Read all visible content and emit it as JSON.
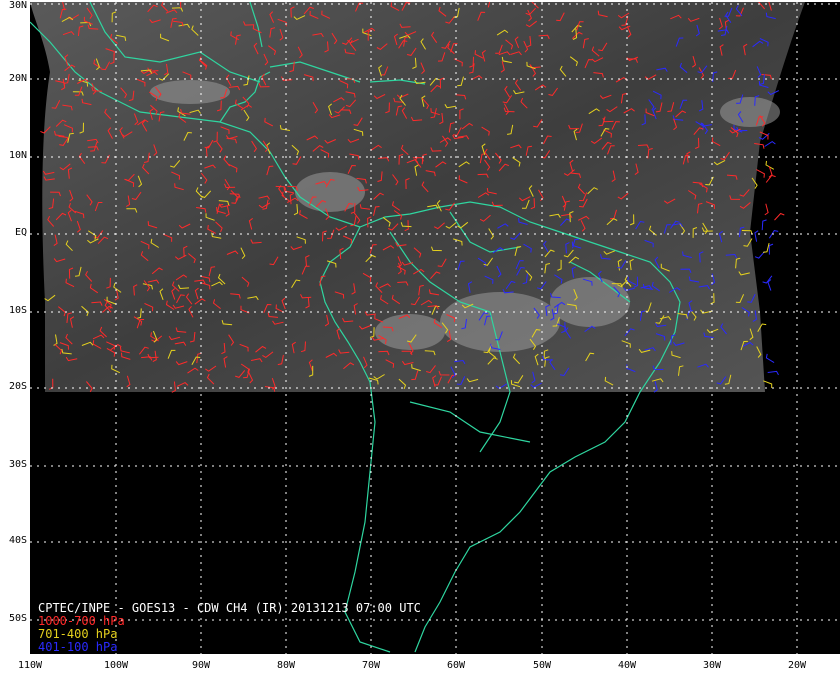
{
  "map": {
    "lat_labels": [
      "30N",
      "20N",
      "10N",
      "EQ",
      "10S",
      "20S",
      "30S",
      "40S",
      "50S"
    ],
    "lon_labels": [
      "110W",
      "100W",
      "90W",
      "80W",
      "70W",
      "60W",
      "50W",
      "40W",
      "30W",
      "20W"
    ],
    "extent": {
      "lon_min": -110,
      "lon_max": -15,
      "lat_min": -55,
      "lat_max": 30
    }
  },
  "caption": {
    "title": "CPTEC/INPE - GOES13 - CDW CH4 (IR) 20131213 07:00 UTC",
    "legend": [
      {
        "label": "1000-700 hPa",
        "color": "#ff2a2a"
      },
      {
        "label": "701-400 hPa",
        "color": "#e6d21e"
      },
      {
        "label": "401-100 hPa",
        "color": "#2a2aff"
      }
    ]
  },
  "colors": {
    "background": "#000000",
    "coastline": "#2fd6a0",
    "grid": "#ffffff",
    "satellite_image": "#4a4a4a"
  }
}
